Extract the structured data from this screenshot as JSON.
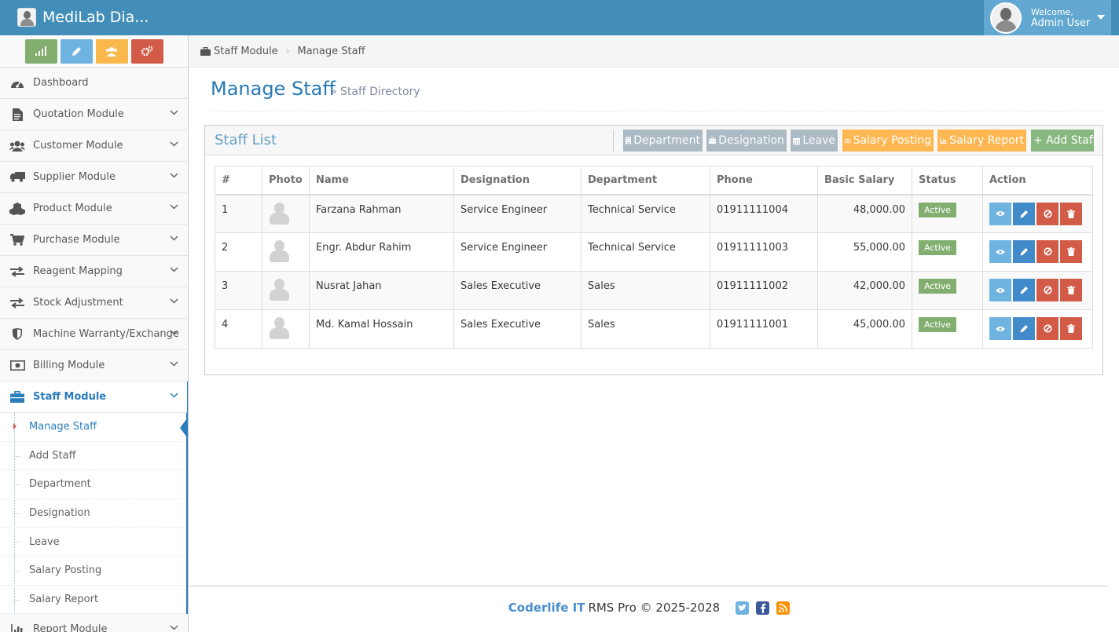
{
  "app": {
    "brand": "MediLab Dia...",
    "welcome": "Welcome,",
    "user_name": "Admin User"
  },
  "colors": {
    "navbar": "#438eb9",
    "accent": "#2b7dbc",
    "active_badge": "#82af6f",
    "btn_yellow": "#ffb752",
    "btn_green": "#87b87f",
    "btn_gray": "#abbac3"
  },
  "sidebar": {
    "shortcuts": [
      {
        "icon": "signal-icon"
      },
      {
        "icon": "pencil-icon"
      },
      {
        "icon": "users-icon"
      },
      {
        "icon": "cogs-icon"
      }
    ],
    "items": [
      {
        "label": "Dashboard",
        "icon": "dashboard-icon"
      },
      {
        "label": "Quotation Module",
        "icon": "file-icon"
      },
      {
        "label": "Customer Module",
        "icon": "users-icon"
      },
      {
        "label": "Supplier Module",
        "icon": "truck-icon"
      },
      {
        "label": "Product Module",
        "icon": "cubes-icon"
      },
      {
        "label": "Purchase Module",
        "icon": "cart-icon"
      },
      {
        "label": "Reagent Mapping",
        "icon": "exchange-icon"
      },
      {
        "label": "Stock Adjustment",
        "icon": "exchange-icon"
      },
      {
        "label": "Machine Warranty/Exchange",
        "icon": "shield-icon"
      },
      {
        "label": "Billing Module",
        "icon": "money-icon"
      },
      {
        "label": "Staff Module",
        "icon": "briefcase-icon"
      },
      {
        "label": "Report Module",
        "icon": "bar-chart-icon"
      }
    ],
    "staff_submenu": [
      "Manage Staff",
      "Add Staff",
      "Department",
      "Designation",
      "Leave",
      "Salary Posting",
      "Salary Report"
    ]
  },
  "breadcrumb": {
    "module": "Staff Module",
    "page": "Manage Staff"
  },
  "page": {
    "title": "Manage Staff",
    "subtitle": "» Staff Directory"
  },
  "widget": {
    "title": "Staff List",
    "buttons": {
      "department": "Department",
      "designation": "Designation",
      "leave": "Leave",
      "salary_posting": "Salary Posting",
      "salary_report": "Salary Report",
      "add_staff": "+ Add Staff"
    }
  },
  "table": {
    "headers": [
      "#",
      "Photo",
      "Name",
      "Designation",
      "Department",
      "Phone",
      "Basic Salary",
      "Status",
      "Action"
    ],
    "rows": [
      {
        "no": "1",
        "name": "Farzana Rahman",
        "designation": "Service Engineer",
        "department": "Technical Service",
        "phone": "01911111004",
        "salary": "48,000.00",
        "status": "Active"
      },
      {
        "no": "2",
        "name": "Engr. Abdur Rahim",
        "designation": "Service Engineer",
        "department": "Technical Service",
        "phone": "01911111003",
        "salary": "55,000.00",
        "status": "Active"
      },
      {
        "no": "3",
        "name": "Nusrat Jahan",
        "designation": "Sales Executive",
        "department": "Sales",
        "phone": "01911111002",
        "salary": "42,000.00",
        "status": "Active"
      },
      {
        "no": "4",
        "name": "Md. Kamal Hossain",
        "designation": "Sales Executive",
        "department": "Sales",
        "phone": "01911111001",
        "salary": "45,000.00",
        "status": "Active"
      }
    ]
  },
  "footer": {
    "company": "Coderlife IT",
    "product": "RMS Pro © 2025-2028",
    "social": [
      "twitter-icon",
      "facebook-icon",
      "rss-icon"
    ]
  }
}
